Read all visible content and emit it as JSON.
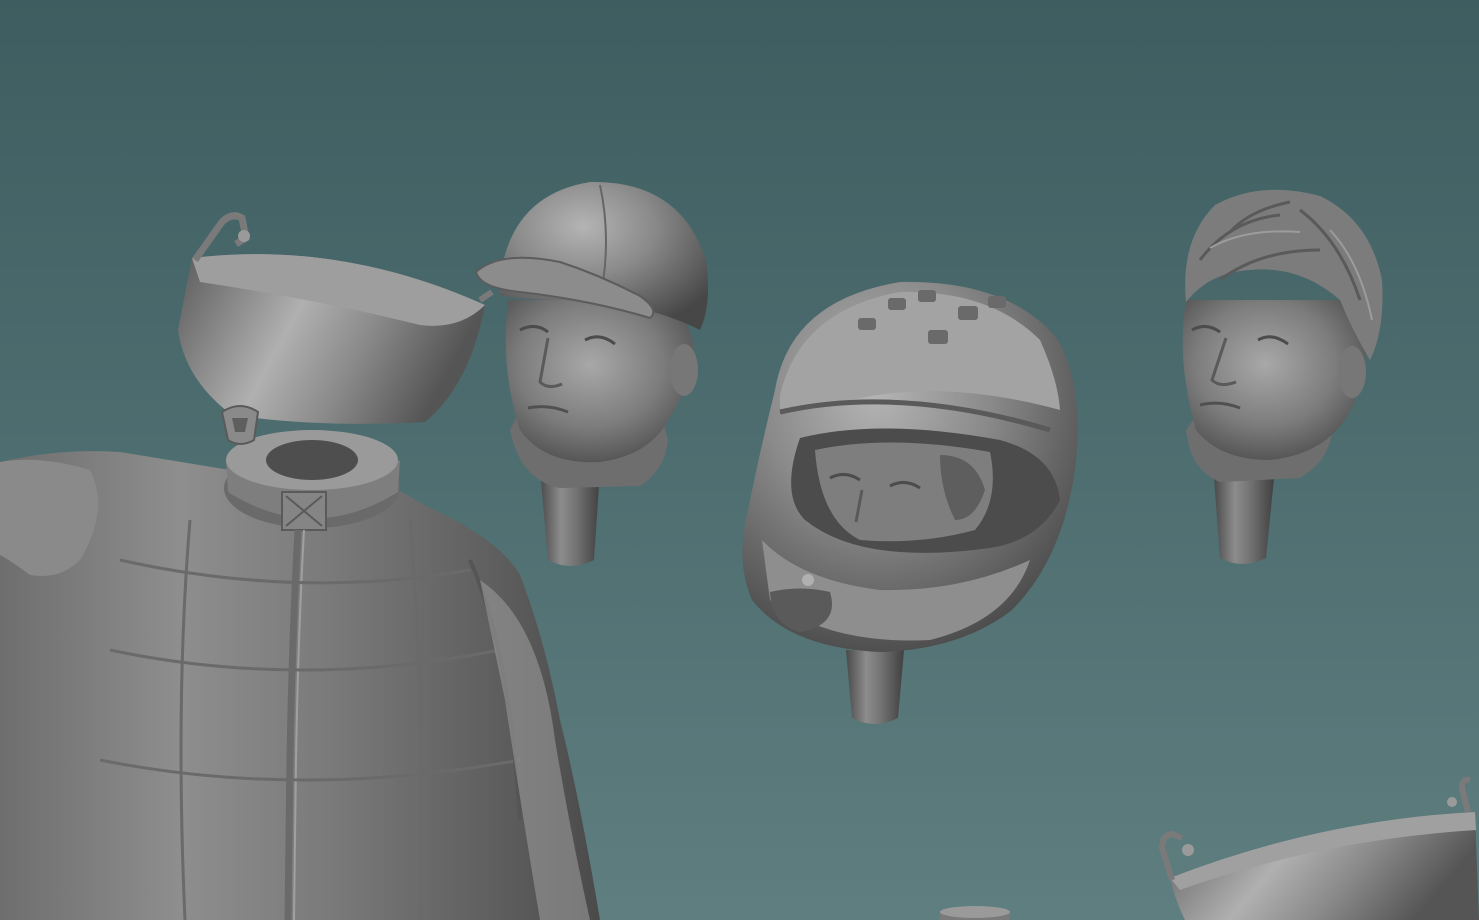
{
  "viewport": {
    "background_top": "#3d5d60",
    "background_bottom": "#5e7e80",
    "model_base_color": "#7a7a7a",
    "model_shadow_color": "#3e3e3e",
    "model_highlight_color": "#b4b4b4"
  },
  "objects": [
    {
      "id": "visor-open",
      "kind": "helmet visor with hinge"
    },
    {
      "id": "torso",
      "kind": "racing suit torso with neck socket"
    },
    {
      "id": "head-cap",
      "kind": "head wearing baseball cap on peg"
    },
    {
      "id": "head-full-helmet",
      "kind": "head inside full-face helmet on peg"
    },
    {
      "id": "head-bare",
      "kind": "bare head with hair on peg"
    },
    {
      "id": "visor-lower-right",
      "kind": "loose visor piece"
    },
    {
      "id": "small-part-bottom",
      "kind": "small cylindrical part"
    }
  ]
}
